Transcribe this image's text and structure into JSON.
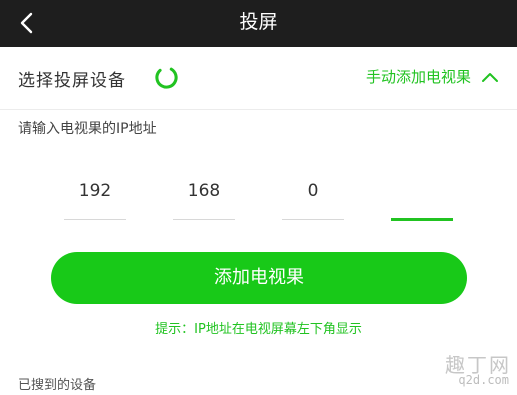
{
  "header": {
    "title": "投屏"
  },
  "device_select": {
    "label": "选择投屏设备",
    "manual_add_label": "手动添加电视果"
  },
  "ip_entry": {
    "prompt": "请输入电视果的IP地址",
    "octets": [
      "192",
      "168",
      "0",
      ""
    ]
  },
  "add_button_label": "添加电视果",
  "hint": "提示：IP地址在电视屏幕左下角显示",
  "found_devices_label": "已搜到的设备",
  "watermark": {
    "line1": "趣丁网",
    "line2": "q2d.com"
  },
  "colors": {
    "accent": "#18c918",
    "topbar": "#1e1e1e"
  }
}
